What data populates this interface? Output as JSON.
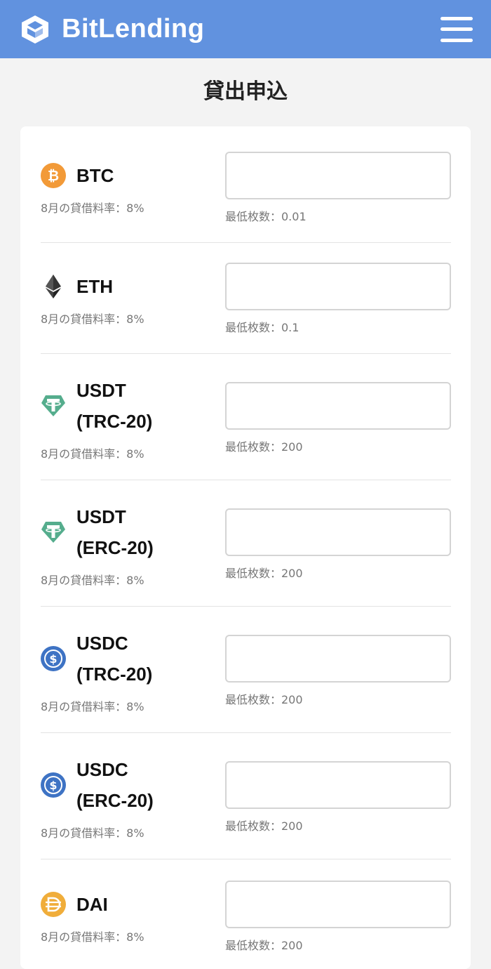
{
  "header": {
    "brand": "BitLending",
    "logo_icon": "bitlending-cube-logo-icon",
    "menu_icon": "hamburger-menu-icon",
    "color": "#6192df"
  },
  "page": {
    "title": "貸出申込"
  },
  "coins": [
    {
      "name": "BTC",
      "rate": "8月の貸借料率：8%",
      "min": "最低枚数：0.01",
      "icon": "bitcoin-icon"
    },
    {
      "name": "ETH",
      "rate": "8月の貸借料率：8%",
      "min": "最低枚数：0.1",
      "icon": "ethereum-icon"
    },
    {
      "name": "USDT\n(TRC-20)",
      "rate": "8月の貸借料率：8%",
      "min": "最低枚数：200",
      "icon": "tether-icon"
    },
    {
      "name": "USDT\n(ERC-20)",
      "rate": "8月の貸借料率：8%",
      "min": "最低枚数：200",
      "icon": "tether-icon"
    },
    {
      "name": "USDC\n(TRC-20)",
      "rate": "8月の貸借料率：8%",
      "min": "最低枚数：200",
      "icon": "usdc-icon"
    },
    {
      "name": "USDC\n(ERC-20)",
      "rate": "8月の貸借料率：8%",
      "min": "最低枚数：200",
      "icon": "usdc-icon"
    },
    {
      "name": "DAI",
      "rate": "8月の貸借料率：8%",
      "min": "最低枚数：200",
      "icon": "dai-icon"
    }
  ]
}
